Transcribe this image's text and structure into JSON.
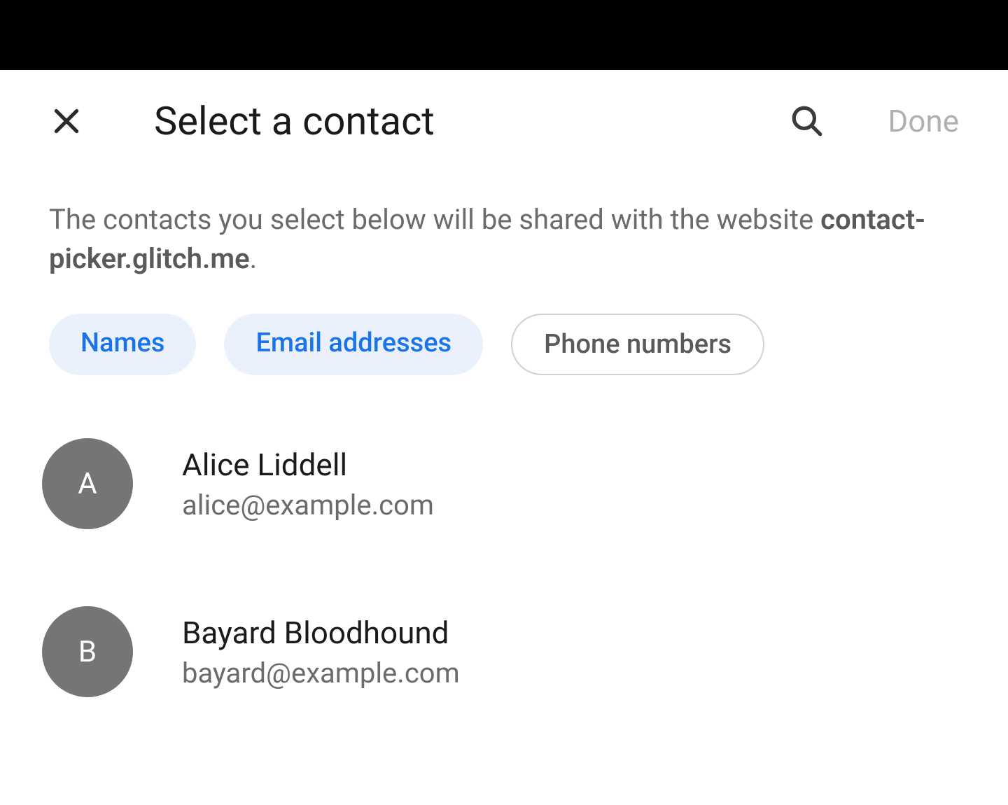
{
  "header": {
    "title": "Select a contact",
    "done_label": "Done"
  },
  "description": {
    "text_prefix": "The contacts you select below will be shared with the website ",
    "domain": "contact-picker.glitch.me",
    "text_suffix": "."
  },
  "chips": [
    {
      "label": "Names",
      "selected": true
    },
    {
      "label": "Email addresses",
      "selected": true
    },
    {
      "label": "Phone numbers",
      "selected": false
    }
  ],
  "contacts": [
    {
      "initial": "A",
      "name": "Alice Liddell",
      "email": "alice@example.com"
    },
    {
      "initial": "B",
      "name": "Bayard Bloodhound",
      "email": "bayard@example.com"
    }
  ]
}
